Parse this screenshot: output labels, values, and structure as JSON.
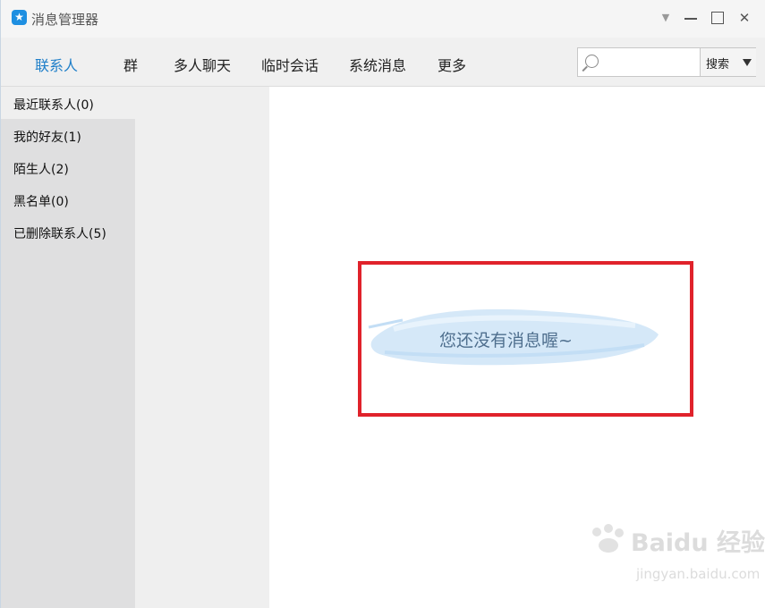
{
  "window": {
    "title": "消息管理器",
    "icon": "star-bubble-icon",
    "controls": {
      "menu": "▼",
      "minimize": "minimize-icon",
      "maximize": "maximize-icon",
      "close": "✕"
    }
  },
  "nav": {
    "tabs": [
      {
        "label": "联系人",
        "active": true
      },
      {
        "label": "群",
        "active": false
      },
      {
        "label": "多人聊天",
        "active": false
      },
      {
        "label": "临时会话",
        "active": false
      },
      {
        "label": "系统消息",
        "active": false
      },
      {
        "label": "更多",
        "active": false
      }
    ],
    "search": {
      "placeholder": "",
      "value": "",
      "button_label": "搜索"
    }
  },
  "sidebar": {
    "items": [
      {
        "label": "最近联系人(0)",
        "selected": true
      },
      {
        "label": "我的好友(1)",
        "selected": false
      },
      {
        "label": "陌生人(2)",
        "selected": false
      },
      {
        "label": "黑名单(0)",
        "selected": false
      },
      {
        "label": "已删除联系人(5)",
        "selected": false
      }
    ]
  },
  "main": {
    "empty_message": "您还没有消息喔~",
    "highlight_color": "#e0222b"
  },
  "watermark": {
    "text": "Baidu 经验",
    "url": "jingyan.baidu.com"
  },
  "colors": {
    "accent": "#1f7fc9",
    "sidebar_bg": "#dfdfe0",
    "nav_bg": "#f0f0f0"
  }
}
